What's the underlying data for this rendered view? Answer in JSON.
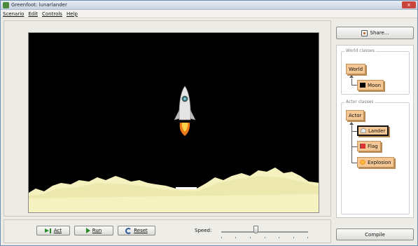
{
  "window": {
    "title": "Greenfoot: lunarlander",
    "close_label": "x"
  },
  "menu": [
    {
      "label": "Scenario"
    },
    {
      "label": "Edit"
    },
    {
      "label": "Controls"
    },
    {
      "label": "Help"
    }
  ],
  "controls": {
    "act_label": "Act",
    "run_label": "Run",
    "reset_label": "Reset",
    "speed_label": "Speed:",
    "speed_value": 0.4
  },
  "share_label": "Share...",
  "compile_label": "Compile",
  "world_classes": {
    "label": "World classes",
    "items": [
      {
        "label": "World"
      },
      {
        "label": "Moon"
      }
    ]
  },
  "actor_classes": {
    "label": "Actor classes",
    "items": [
      {
        "label": "Actor"
      },
      {
        "label": "Lander"
      },
      {
        "label": "Flag"
      },
      {
        "label": "Explosion"
      }
    ]
  },
  "colors": {
    "sky": "#000000",
    "terrain": "#f6f2bf",
    "class_fill": "#f4c795",
    "flame": "#f07a1a"
  }
}
